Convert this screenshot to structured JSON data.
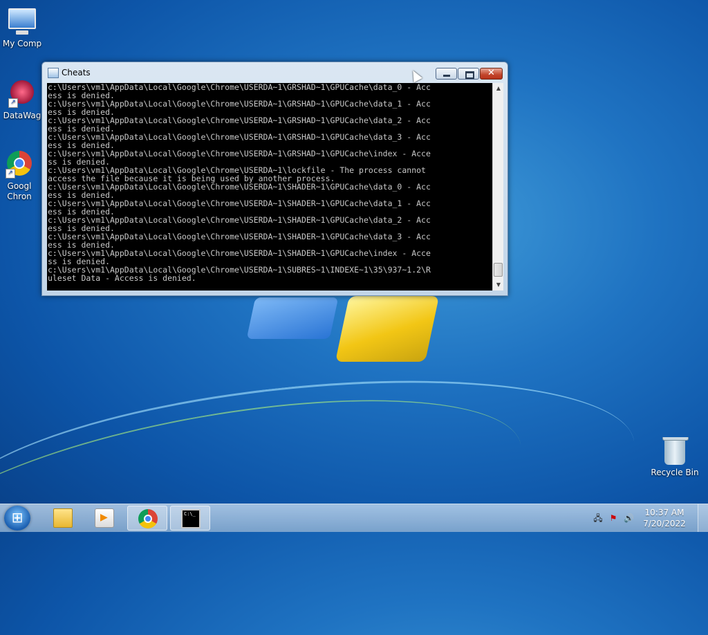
{
  "desktop": {
    "icons": [
      {
        "label": "My Comp",
        "icon": "computer-icon"
      },
      {
        "label": "DataWag",
        "icon": "datawag-icon"
      },
      {
        "label": "Googl Chron",
        "icon": "chrome-icon"
      },
      {
        "label": "Recycle Bin",
        "icon": "recycle-bin-icon"
      }
    ]
  },
  "window": {
    "title": "Cheats",
    "console_lines": [
      "c:\\Users\\vm1\\AppData\\Local\\Google\\Chrome\\USERDA~1\\GRSHAD~1\\GPUCache\\data_0 - Acc",
      "ess is denied.",
      "c:\\Users\\vm1\\AppData\\Local\\Google\\Chrome\\USERDA~1\\GRSHAD~1\\GPUCache\\data_1 - Acc",
      "ess is denied.",
      "c:\\Users\\vm1\\AppData\\Local\\Google\\Chrome\\USERDA~1\\GRSHAD~1\\GPUCache\\data_2 - Acc",
      "ess is denied.",
      "c:\\Users\\vm1\\AppData\\Local\\Google\\Chrome\\USERDA~1\\GRSHAD~1\\GPUCache\\data_3 - Acc",
      "ess is denied.",
      "c:\\Users\\vm1\\AppData\\Local\\Google\\Chrome\\USERDA~1\\GRSHAD~1\\GPUCache\\index - Acce",
      "ss is denied.",
      "c:\\Users\\vm1\\AppData\\Local\\Google\\Chrome\\USERDA~1\\lockfile - The process cannot",
      "access the file because it is being used by another process.",
      "c:\\Users\\vm1\\AppData\\Local\\Google\\Chrome\\USERDA~1\\SHADER~1\\GPUCache\\data_0 - Acc",
      "ess is denied.",
      "c:\\Users\\vm1\\AppData\\Local\\Google\\Chrome\\USERDA~1\\SHADER~1\\GPUCache\\data_1 - Acc",
      "ess is denied.",
      "c:\\Users\\vm1\\AppData\\Local\\Google\\Chrome\\USERDA~1\\SHADER~1\\GPUCache\\data_2 - Acc",
      "ess is denied.",
      "c:\\Users\\vm1\\AppData\\Local\\Google\\Chrome\\USERDA~1\\SHADER~1\\GPUCache\\data_3 - Acc",
      "ess is denied.",
      "c:\\Users\\vm1\\AppData\\Local\\Google\\Chrome\\USERDA~1\\SHADER~1\\GPUCache\\index - Acce",
      "ss is denied.",
      "c:\\Users\\vm1\\AppData\\Local\\Google\\Chrome\\USERDA~1\\SUBRES~1\\INDEXE~1\\35\\937~1.2\\R",
      "uleset Data - Access is denied."
    ]
  },
  "taskbar": {
    "start_icon": "windows-start-icon",
    "items": [
      {
        "icon": "folder-icon"
      },
      {
        "icon": "media-player-icon"
      },
      {
        "icon": "chrome-icon"
      },
      {
        "icon": "cmd-icon",
        "glyph": "C:\\_"
      }
    ],
    "clock": {
      "time": "10:37 AM",
      "date": "7/20/2022"
    }
  }
}
